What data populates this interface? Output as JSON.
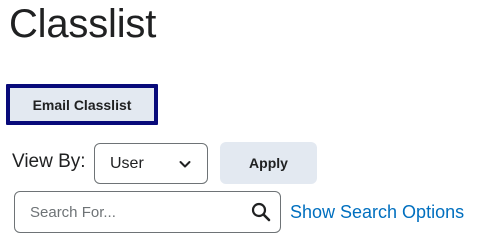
{
  "page": {
    "title": "Classlist"
  },
  "actions": {
    "email_classlist_label": "Email Classlist"
  },
  "view_by": {
    "label": "View By:",
    "selected": "User",
    "apply_label": "Apply"
  },
  "search": {
    "placeholder": "Search For...",
    "value": "",
    "options_link": "Show Search Options"
  },
  "icons": {
    "select_chevron": "chevron-down-icon",
    "search": "search-icon"
  },
  "colors": {
    "text": "#202122",
    "button_bg": "#e3e9f1",
    "focus_ring": "#080a7a",
    "link": "#006fbf",
    "border": "#6e7376"
  }
}
